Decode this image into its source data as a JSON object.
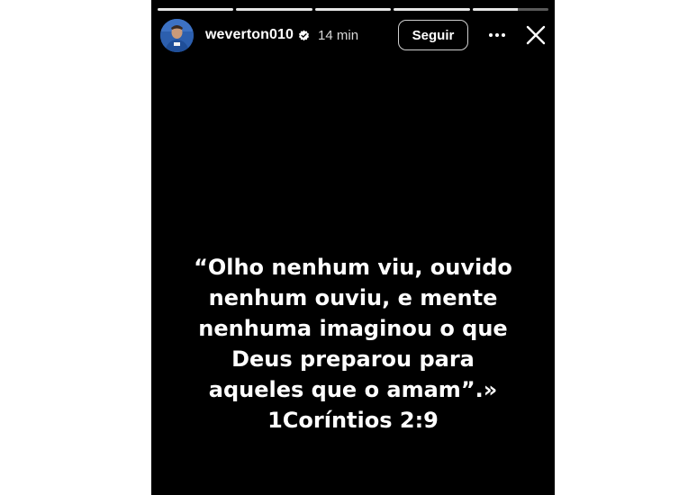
{
  "story": {
    "progress_segments": [
      1.0,
      1.0,
      1.0,
      1.0,
      0.6
    ],
    "user": {
      "username": "weverton010",
      "verified": true,
      "time": "14 min"
    },
    "follow_label": "Seguir",
    "text_lines": [
      "“Olho nenhum viu, ouvido",
      "nenhum ouviu, e mente",
      "nenhuma imaginou o que",
      "Deus preparou para",
      "aqueles que o amam”.»",
      "1Coríntios 2:9"
    ]
  },
  "colors": {
    "background": "#000000",
    "text": "#ffffff",
    "avatar_bg": "#2a5ba8"
  },
  "icons": [
    "verified-badge-icon",
    "more-options-icon",
    "close-icon"
  ]
}
